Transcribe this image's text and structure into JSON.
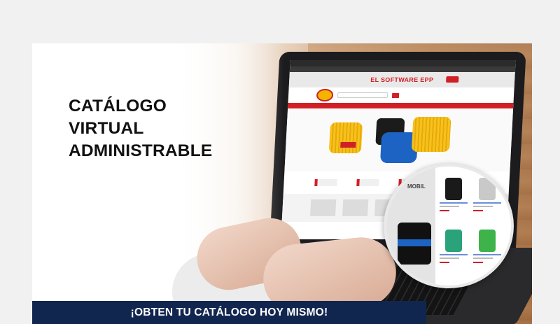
{
  "headline": {
    "line1": "CATÁLOGO",
    "line2": "VIRTUAL",
    "line3": "ADMINISTRABLE"
  },
  "laptop_screen": {
    "promo_text": "EL SOFTWARE EPP"
  },
  "zoom": {
    "brand_label": "MOBIL"
  },
  "cta": {
    "label": "¡OBTEN TU CATÁLOGO HOY MISMO!"
  },
  "colors": {
    "accent_red": "#d21f26",
    "cta_navy": "#11264f"
  }
}
